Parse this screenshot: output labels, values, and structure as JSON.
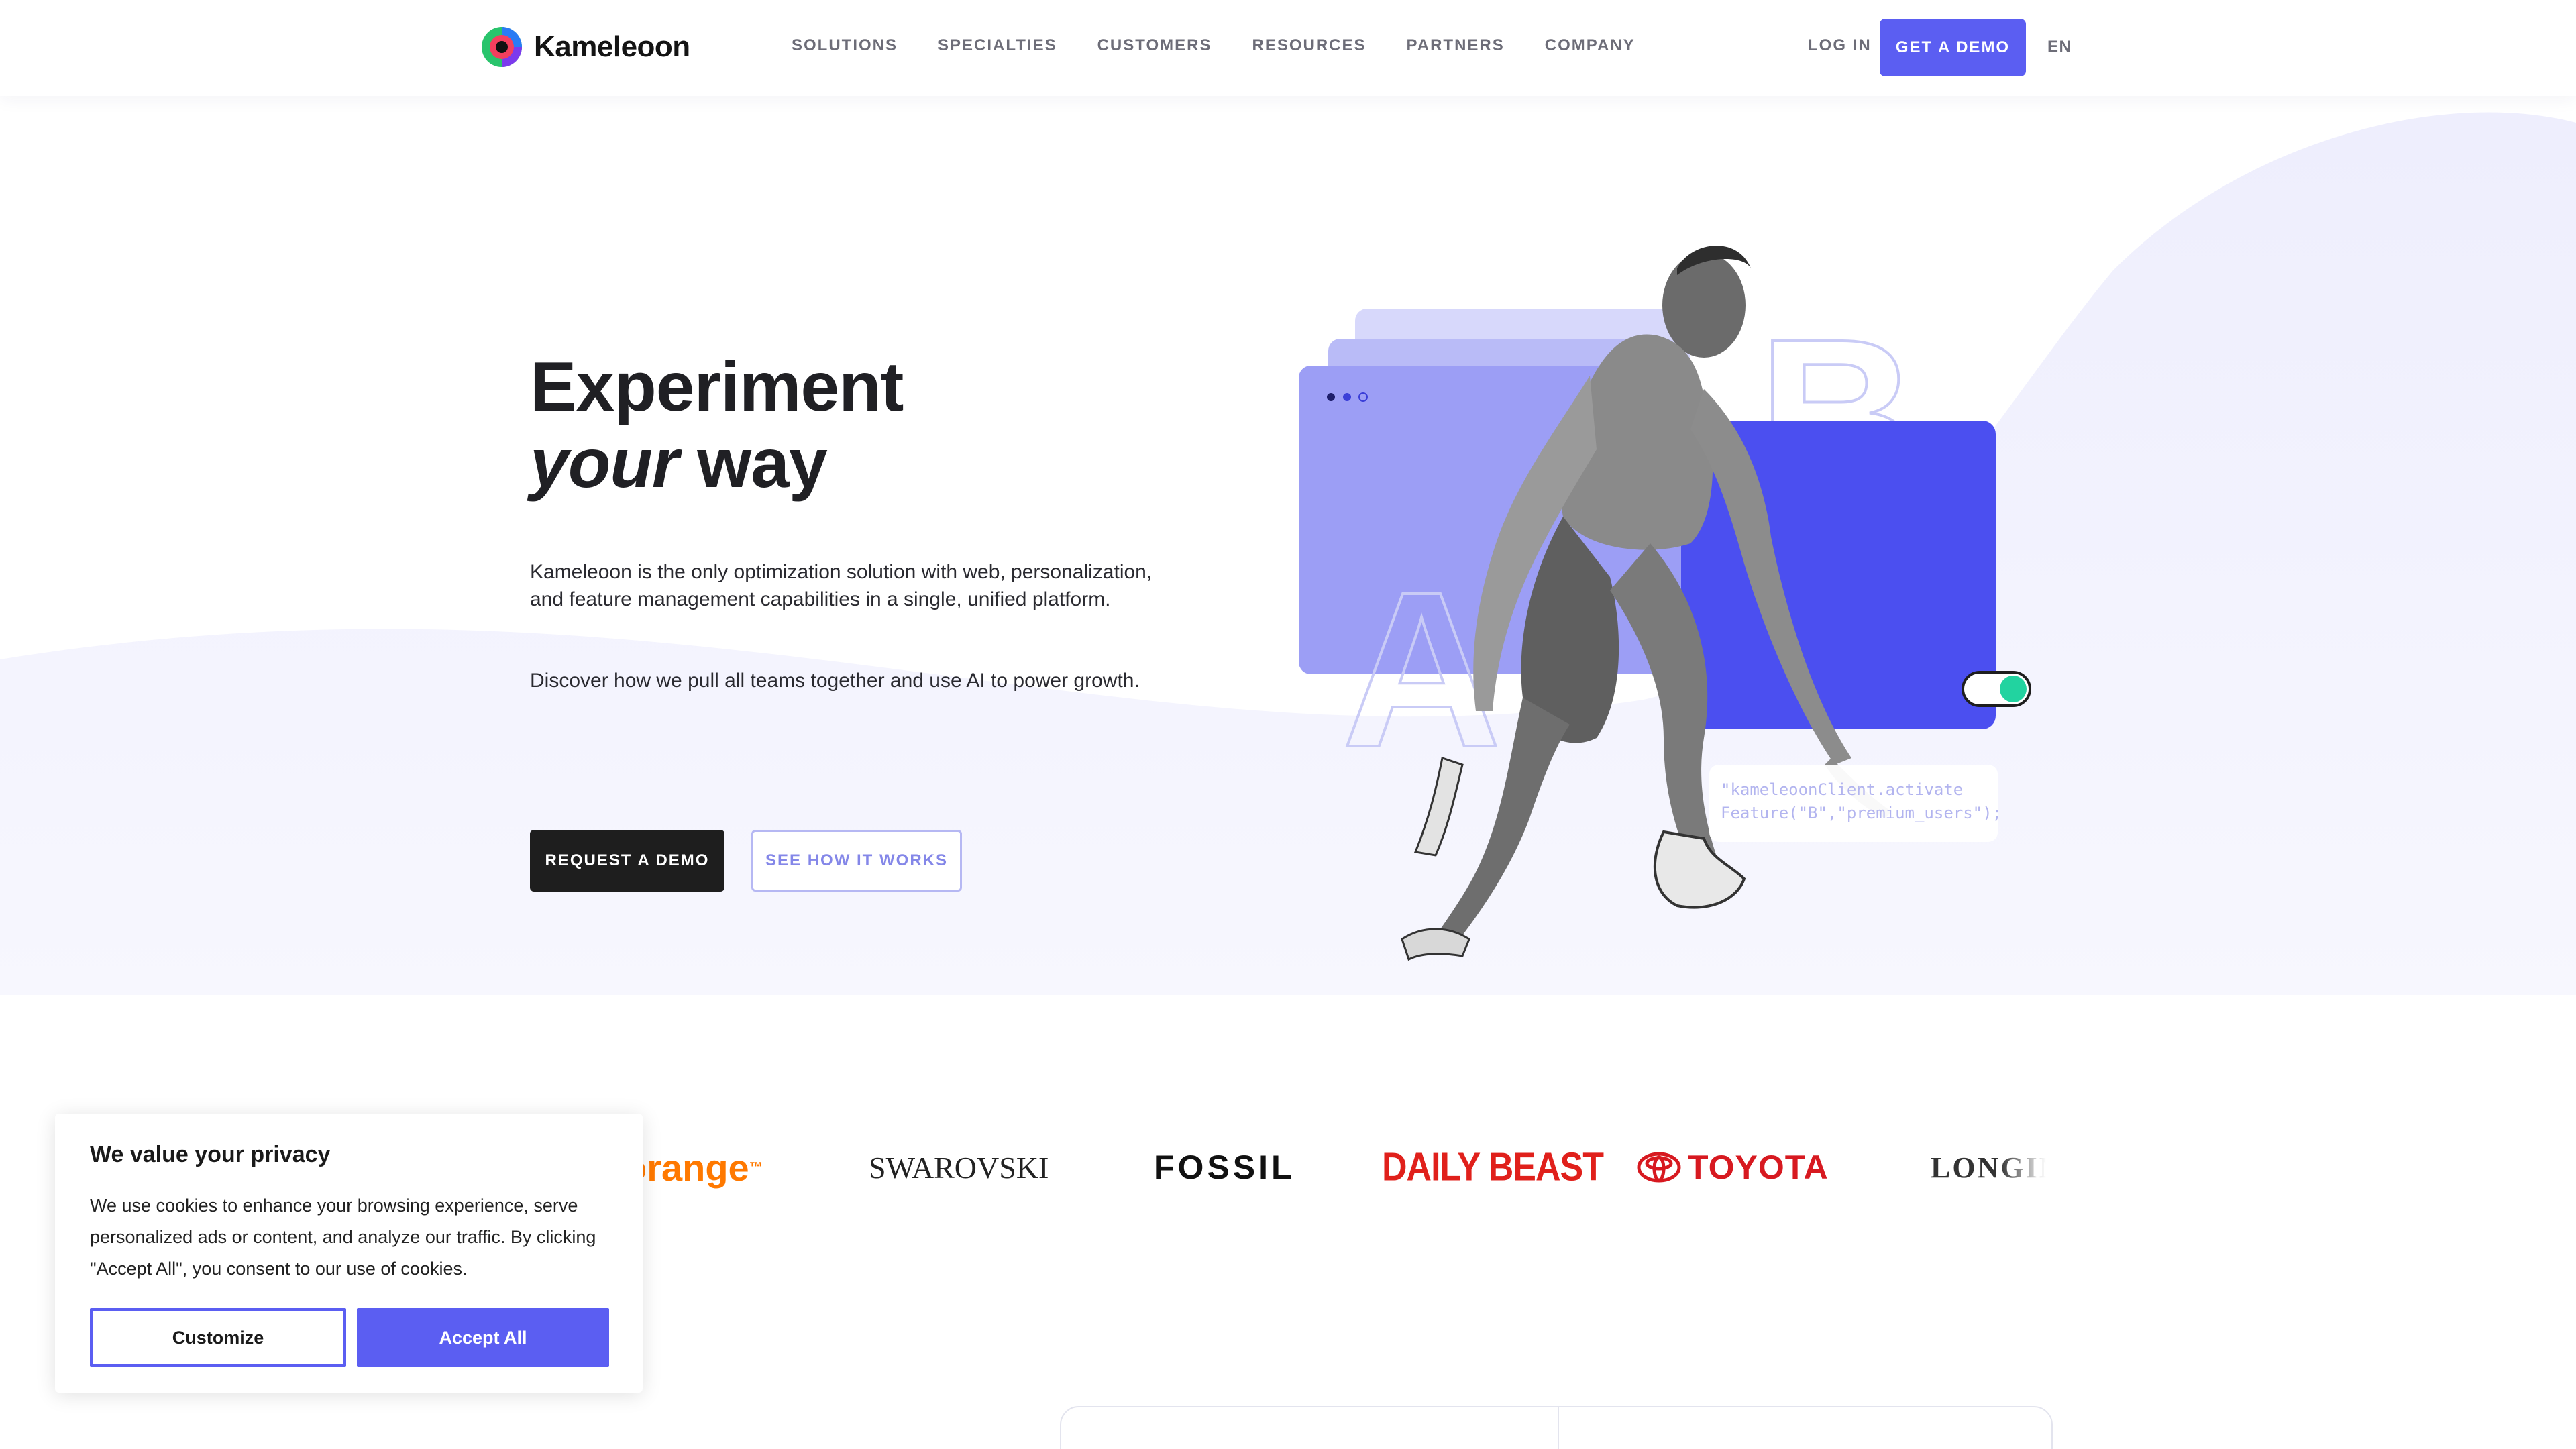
{
  "header": {
    "logo_text": "Kameleoon",
    "nav": [
      "SOLUTIONS",
      "SPECIALTIES",
      "CUSTOMERS",
      "RESOURCES",
      "PARTNERS",
      "COMPANY"
    ],
    "login": "LOG IN",
    "demo_button": "GET A DEMO",
    "language": "EN"
  },
  "hero": {
    "title_line1": "Experiment",
    "title_em": "your",
    "title_rest": " way",
    "paragraph1": "Kameleoon is the only optimization solution with web, personalization, and feature management capabilities in a single, unified platform.",
    "paragraph2": "Discover how we pull all teams together and use AI to power growth.",
    "primary_button": "REQUEST A DEMO",
    "secondary_button": "SEE HOW IT WORKS",
    "code_line1": "\"kameleoonClient.activate",
    "code_line2": "Feature(\"B\",\"premium_users\");",
    "letter_a": "A",
    "letter_b": "B"
  },
  "logos": {
    "orange": "orange",
    "orange_tm": "™",
    "swarovski": "SWAROVSKI",
    "fossil": "FOSSIL",
    "daily_beast": "DAILY BEAST",
    "toyota": "TOYOTA",
    "longines": "LONGINES"
  },
  "cookie": {
    "title": "We value your privacy",
    "text": "We use cookies to enhance your browsing experience, serve personalized ads or content, and analyze our traffic. By clicking \"Accept All\", you consent to our use of cookies.",
    "customize": "Customize",
    "accept": "Accept All"
  },
  "colors": {
    "accent": "#5b5ef2",
    "lavender": "#9b9df4",
    "toggle": "#22d3a0"
  }
}
